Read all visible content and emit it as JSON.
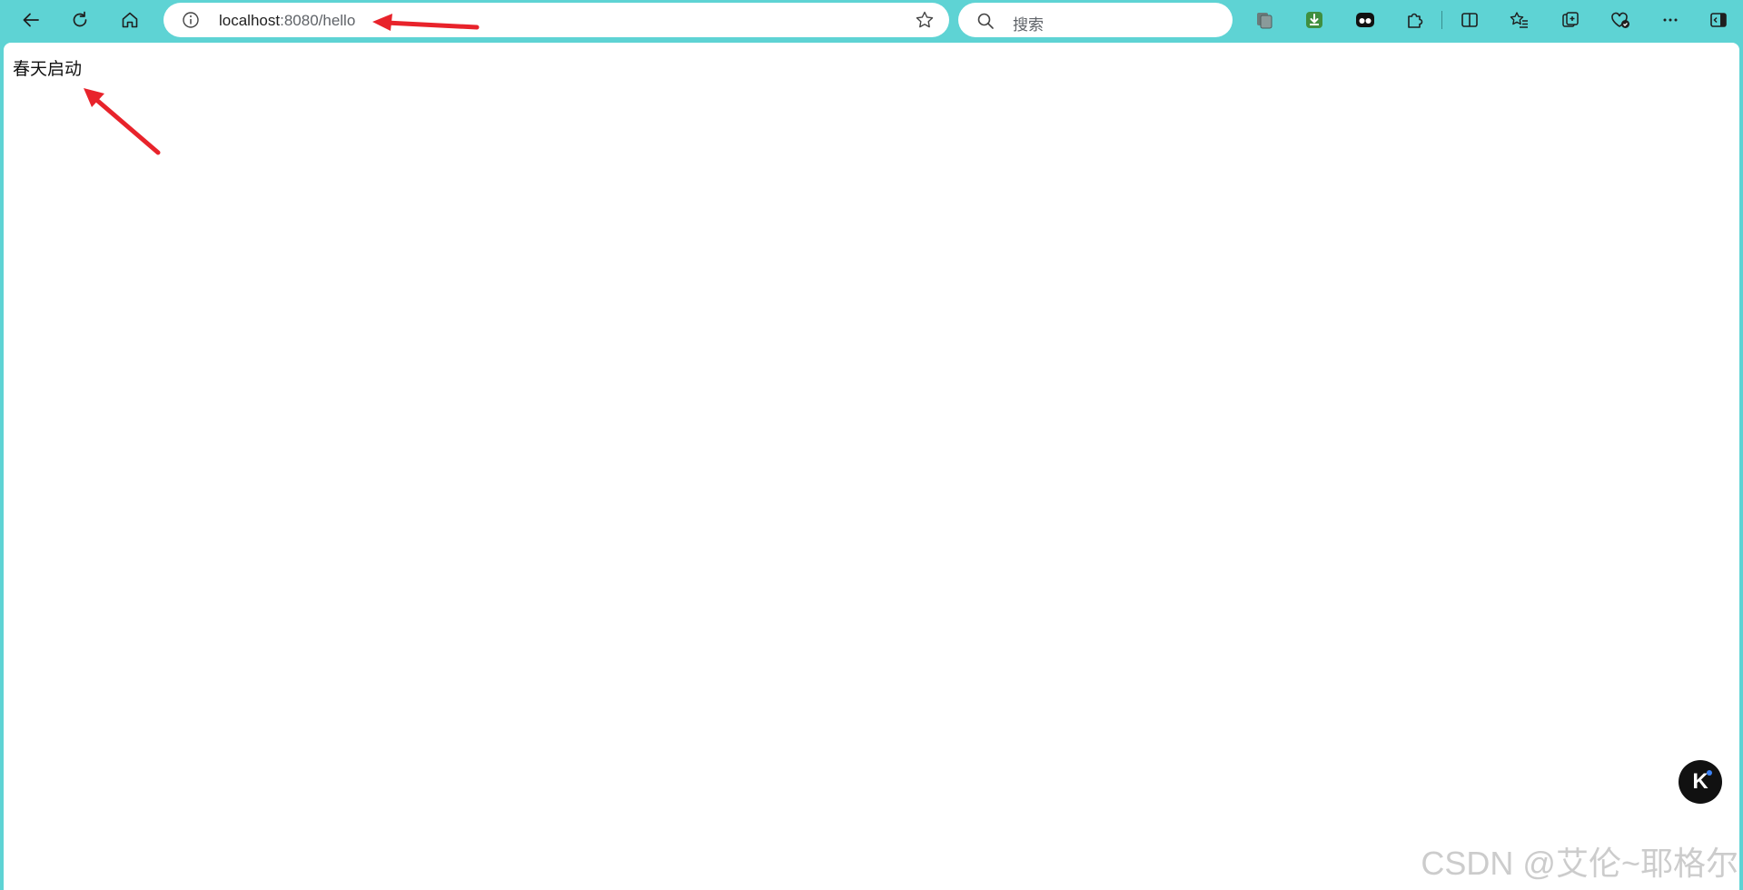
{
  "browser": {
    "url_host": "localhost",
    "url_rest": ":8080/hello",
    "search_placeholder": "搜索",
    "toolbar_icons": [
      "back-arrow-icon",
      "refresh-icon",
      "home-icon",
      "info-icon",
      "favorite-star-icon",
      "search-icon",
      "tab-actions-icon",
      "download-app-icon",
      "copilot-icon",
      "extensions-icon",
      "split-screen-icon",
      "favorites-icon",
      "collections-icon",
      "browser-essentials-icon",
      "more-icon",
      "sidebar-toggle-icon"
    ]
  },
  "page": {
    "text": "春天启动"
  },
  "floating_button": {
    "label": "K"
  },
  "watermark": "CSDN @艾伦~耶格尔",
  "colors": {
    "chrome_bg": "#5ed3d4",
    "annotation_arrow": "#e8232b"
  }
}
